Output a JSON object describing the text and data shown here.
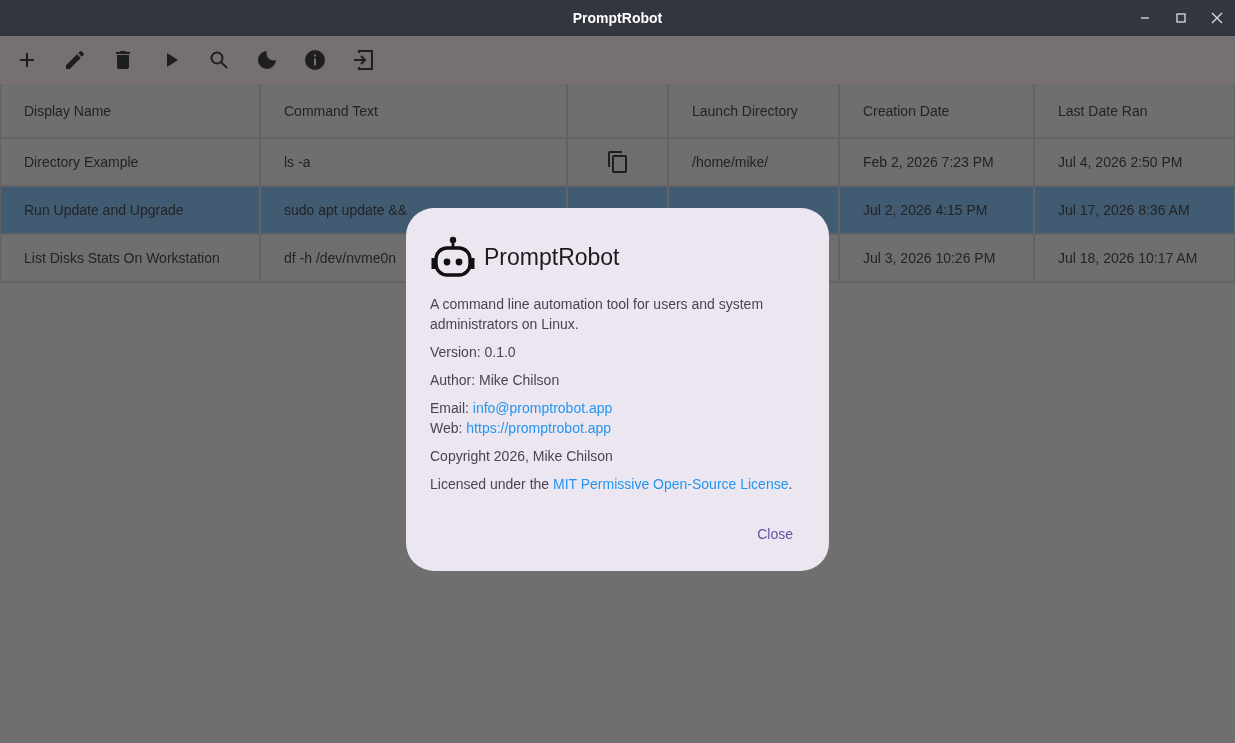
{
  "window": {
    "title": "PromptRobot"
  },
  "toolbar": [
    {
      "kind": "add"
    },
    {
      "kind": "edit"
    },
    {
      "kind": "delete"
    },
    {
      "kind": "run"
    },
    {
      "kind": "search"
    },
    {
      "kind": "theme"
    },
    {
      "kind": "info"
    },
    {
      "kind": "exit"
    }
  ],
  "table": {
    "columns": [
      {
        "label": "Display Name"
      },
      {
        "label": "Command Text"
      },
      {
        "kind": "copy"
      },
      {
        "label": "Launch Directory"
      },
      {
        "label": "Creation Date"
      },
      {
        "label": "Last Date Ran"
      }
    ],
    "rows": [
      {
        "selected": false,
        "display_name": "Directory Example",
        "command_text": "ls -a",
        "copy_button": true,
        "launch_directory": "/home/mike/",
        "creation_date": "Feb 2, 2026 7:23 PM",
        "last_date_ran": "Jul 4, 2026 2:50 PM"
      },
      {
        "selected": true,
        "display_name": "Run Update and Upgrade",
        "command_text": "sudo apt update &&",
        "creation_date": "Jul 2, 2026 4:15 PM",
        "last_date_ran": "Jul 17, 2026 8:36 AM"
      },
      {
        "selected": false,
        "display_name": "List Disks Stats On Workstation",
        "command_text": "df -h /dev/nvme0n",
        "creation_date": "Jul 3, 2026 10:26 PM",
        "last_date_ran": "Jul 18, 2026 10:17 AM"
      }
    ]
  },
  "dialog": {
    "title": "PromptRobot",
    "description": "A command line automation tool for users and system administrators on Linux.",
    "version": "Version: 0.1.0",
    "author": "Author: Mike Chilson",
    "email_label": "Email:",
    "email": "info@promptrobot.app",
    "web_label": "Web:",
    "web": "https://promptrobot.app",
    "copyright": "Copyright 2026, Mike Chilson",
    "license_prefix": "Licensed under the",
    "license_link": "MIT Permissive Open-Source License",
    "license_suffix": ".",
    "close": "Close"
  }
}
